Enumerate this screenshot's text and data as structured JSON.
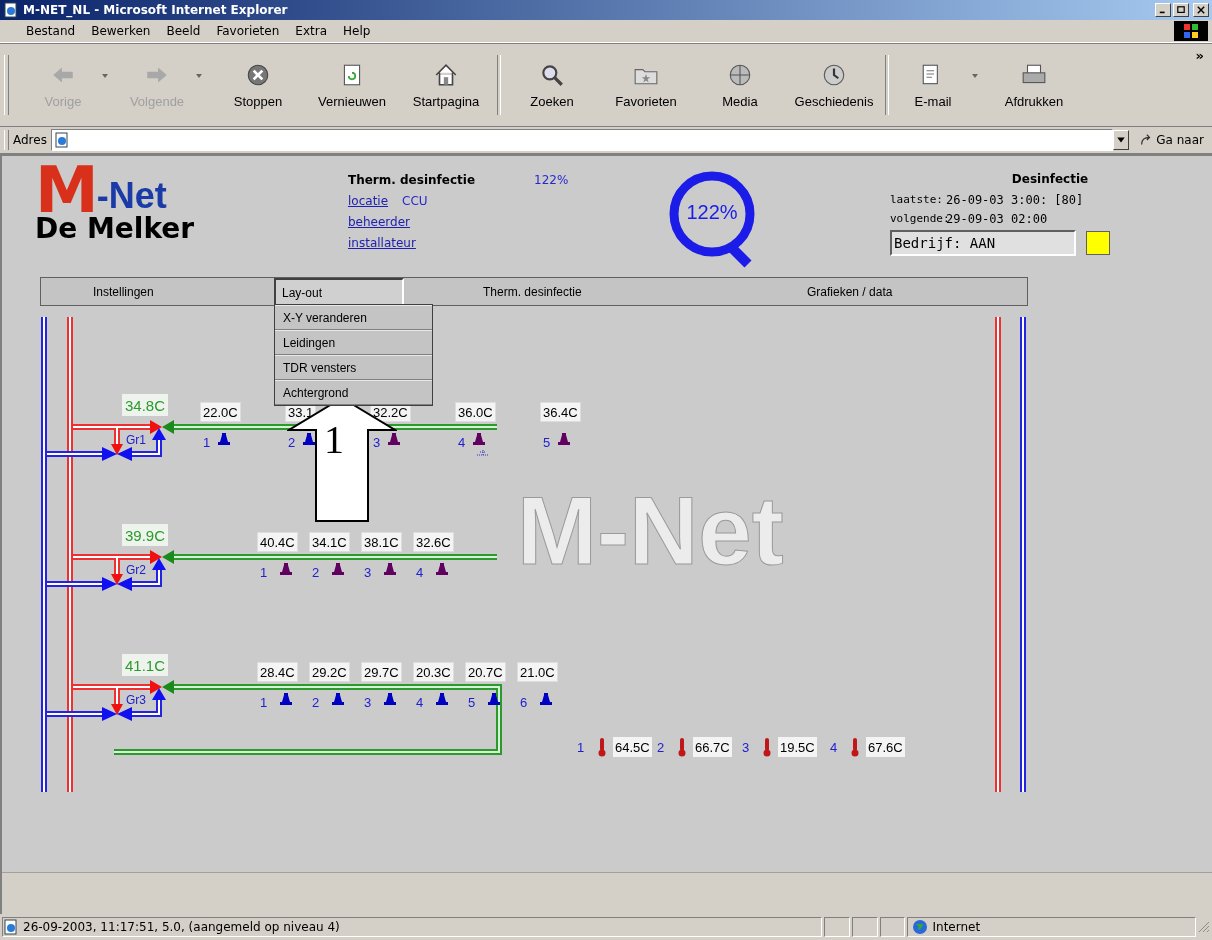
{
  "window": {
    "title": "M-NET_NL - Microsoft Internet Explorer"
  },
  "menu": [
    "Bestand",
    "Bewerken",
    "Beeld",
    "Favorieten",
    "Extra",
    "Help"
  ],
  "toolbar": {
    "overflow": "»",
    "buttons": [
      {
        "label": "Vorige",
        "disabled": true,
        "dropdown": true
      },
      {
        "label": "Volgende",
        "disabled": true,
        "dropdown": true
      },
      {
        "label": "Stoppen",
        "disabled": false,
        "dropdown": false
      },
      {
        "label": "Vernieuwen",
        "disabled": false,
        "dropdown": false
      },
      {
        "label": "Startpagina",
        "disabled": false,
        "dropdown": false
      },
      {
        "label": "Zoeken",
        "disabled": false,
        "dropdown": false
      },
      {
        "label": "Favorieten",
        "disabled": false,
        "dropdown": false
      },
      {
        "label": "Media",
        "disabled": false,
        "dropdown": false
      },
      {
        "label": "Geschiedenis",
        "disabled": false,
        "dropdown": false
      },
      {
        "label": "E-mail",
        "disabled": false,
        "dropdown": true
      },
      {
        "label": "Afdrukken",
        "disabled": false,
        "dropdown": false
      }
    ]
  },
  "address_bar": {
    "label": "Adres",
    "go": "Ga naar"
  },
  "header": {
    "logo": {
      "mark": "M",
      "name": "-Net",
      "subtitle": "De Melker"
    },
    "info": {
      "title": "Therm. desinfectie",
      "value": "122%",
      "location_link": "locatie",
      "location": "CCU",
      "links": [
        "beheerder",
        "installateur"
      ]
    },
    "gauge": "122%",
    "disinfection": {
      "title": "Desinfectie",
      "rows": [
        {
          "label": "laatste:",
          "value": "26-09-03 3:00: [80]"
        },
        {
          "label": "volgende:",
          "value": "29-09-03 02:00"
        }
      ],
      "status": "Bedrijf: AAN",
      "indicator_lit": true
    }
  },
  "nav": {
    "tabs": [
      {
        "label": "Instellingen",
        "selected": false
      },
      {
        "label": "Lay-out",
        "selected": true
      },
      {
        "label": "Therm. desinfectie",
        "selected": false
      },
      {
        "label": "Grafieken / data",
        "selected": false
      }
    ],
    "dropdown": [
      "X-Y veranderen",
      "Leidingen",
      "TDR vensters",
      "Achtergrond"
    ]
  },
  "diagram": {
    "background_logo": "M-Net",
    "annotation": "1",
    "groups": [
      {
        "name": "Gr1",
        "temperature": "34.8C",
        "return_line": false,
        "taps": [
          {
            "number": "1",
            "reading": "22.0C",
            "color": "#0000c0",
            "flagged": false
          },
          {
            "number": "2",
            "reading": "33.1",
            "color": "#0000c0",
            "flagged": false
          },
          {
            "number": "3",
            "reading": "32.2C",
            "color": "#600060",
            "flagged": false
          },
          {
            "number": "4",
            "reading": "36.0C",
            "color": "#600060",
            "flagged": true
          },
          {
            "number": "5",
            "reading": "36.4C",
            "color": "#600060",
            "flagged": false
          }
        ]
      },
      {
        "name": "Gr2",
        "temperature": "39.9C",
        "return_line": false,
        "taps": [
          {
            "number": "1",
            "reading": "40.4C",
            "color": "#600060",
            "flagged": false
          },
          {
            "number": "2",
            "reading": "34.1C",
            "color": "#600060",
            "flagged": false
          },
          {
            "number": "3",
            "reading": "38.1C",
            "color": "#600060",
            "flagged": false
          },
          {
            "number": "4",
            "reading": "32.6C",
            "color": "#600060",
            "flagged": false
          }
        ]
      },
      {
        "name": "Gr3",
        "temperature": "41.1C",
        "return_line": true,
        "taps": [
          {
            "number": "1",
            "reading": "28.4C",
            "color": "#0000c0",
            "flagged": false
          },
          {
            "number": "2",
            "reading": "29.2C",
            "color": "#0000c0",
            "flagged": false
          },
          {
            "number": "3",
            "reading": "29.7C",
            "color": "#0000c0",
            "flagged": false
          },
          {
            "number": "4",
            "reading": "20.3C",
            "color": "#0000c0",
            "flagged": false
          },
          {
            "number": "5",
            "reading": "20.7C",
            "color": "#0000c0",
            "flagged": false
          },
          {
            "number": "6",
            "reading": "21.0C",
            "color": "#0000c0",
            "flagged": false
          }
        ]
      }
    ],
    "sensors": [
      {
        "number": "1",
        "reading": "64.5C"
      },
      {
        "number": "2",
        "reading": "66.7C"
      },
      {
        "number": "3",
        "reading": "19.5C"
      },
      {
        "number": "4",
        "reading": "67.6C"
      }
    ]
  },
  "status_bar": {
    "text": "26-09-2003, 11:17:51, 5.0, (aangemeld op niveau 4)",
    "zone": "Internet"
  }
}
